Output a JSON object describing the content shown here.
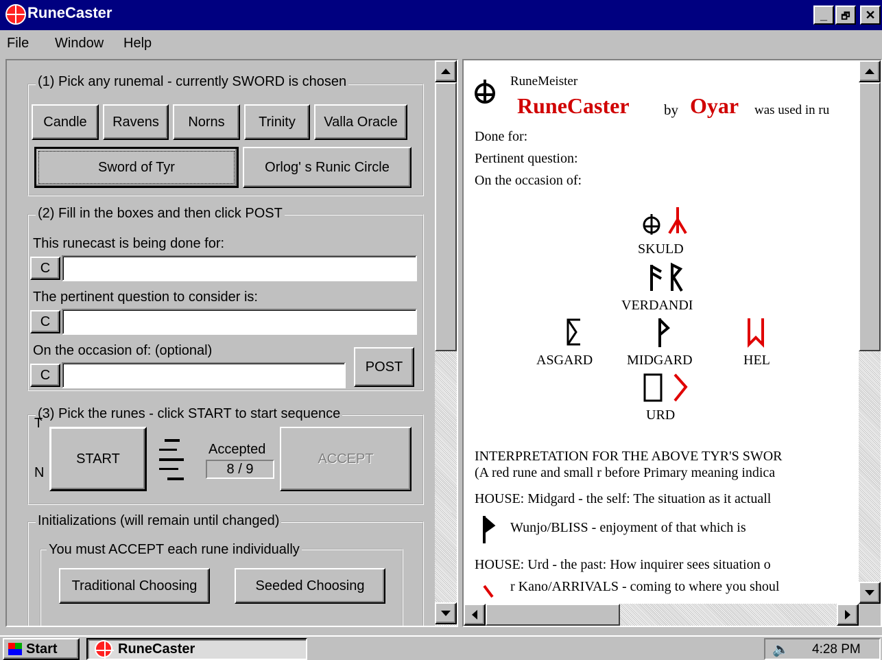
{
  "window": {
    "title": "RuneCaster",
    "min": "_",
    "max": "🗗",
    "close": "✕"
  },
  "menu": {
    "file": "File",
    "window": "Window",
    "help": "Help"
  },
  "step1": {
    "legend": "(1) Pick any runemal - currently SWORD is chosen",
    "buttons": [
      "Candle",
      "Ravens",
      "Norns",
      "Trinity",
      "Valla Oracle"
    ],
    "sword": "Sword of Tyr",
    "orlog": "Orlog' s Runic Circle"
  },
  "step2": {
    "legend": "(2) Fill in the boxes and then click POST",
    "for_label": "This runecast is being done for:",
    "question_label": "The pertinent question to consider is:",
    "occasion_label": "On the occasion of:   (optional)",
    "clear": "C",
    "for_value": "",
    "question_value": "",
    "occasion_value": "",
    "post": "POST"
  },
  "step3": {
    "legend": "(3) Pick the runes - click START to start sequence",
    "t": "T",
    "n": "N",
    "start": "START",
    "accepted_label": "Accepted",
    "accepted_value": "8 / 9",
    "accept": "ACCEPT"
  },
  "init": {
    "legend": "Initializations (will remain until changed)",
    "inner_legend": "You must ACCEPT each rune individually",
    "traditional": "Traditional Choosing",
    "seeded": "Seeded Choosing"
  },
  "report": {
    "runemeister": "RuneMeister",
    "app": "RuneCaster",
    "by": "by",
    "author": "Oyar",
    "used": "was used in ru",
    "done_for": "Done for:",
    "question": "Pertinent question:",
    "occasion": "On the occasion of:",
    "skuld": "SKULD",
    "verdandi": "VERDANDI",
    "asgard": "ASGARD",
    "midgard": "MIDGARD",
    "hel": "HEL",
    "urd": "URD",
    "interp1": "INTERPRETATION FOR THE ABOVE TYR'S SWOR",
    "interp2": "(A red rune and small r before Primary meaning indica",
    "house1": "HOUSE: Midgard - the self: The situation as it actuall",
    "wunjo": "Wunjo/BLISS - enjoyment of that which is",
    "house2": "HOUSE: Urd - the past: How inquirer sees situation o",
    "kano": "r Kano/ARRIVALS - coming to where you shoul"
  },
  "colors": {
    "red": "#e00000",
    "accent": "#000080"
  },
  "taskbar": {
    "start": "Start",
    "task": "RuneCaster",
    "time": "4:28 PM"
  }
}
